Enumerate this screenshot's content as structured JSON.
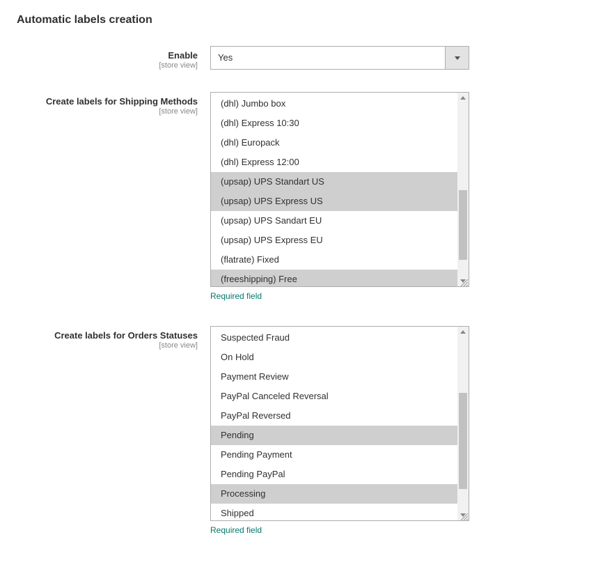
{
  "section": {
    "title": "Automatic labels creation"
  },
  "fields": {
    "enable": {
      "label": "Enable",
      "scope": "[store view]",
      "value": "Yes"
    },
    "shipping_methods": {
      "label": "Create labels for Shipping Methods",
      "scope": "[store view]",
      "note": "Required field",
      "items": [
        {
          "text": "(dhl) Jumbo box",
          "selected": false
        },
        {
          "text": "(dhl) Express 10:30",
          "selected": false
        },
        {
          "text": "(dhl) Europack",
          "selected": false
        },
        {
          "text": "(dhl) Express 12:00",
          "selected": false
        },
        {
          "text": "(upsap) UPS Standart US",
          "selected": true
        },
        {
          "text": "(upsap) UPS Express US",
          "selected": true
        },
        {
          "text": "(upsap) UPS Sandart EU",
          "selected": false
        },
        {
          "text": "(upsap) UPS Express EU",
          "selected": false
        },
        {
          "text": "(flatrate) Fixed",
          "selected": false
        },
        {
          "text": "(freeshipping) Free",
          "selected": true
        }
      ],
      "scrollbar": {
        "thumb_top_pct": 50,
        "thumb_height_pct": 40
      }
    },
    "order_statuses": {
      "label": "Create labels for Orders Statuses",
      "scope": "[store view]",
      "note": "Required field",
      "items": [
        {
          "text": "Suspected Fraud",
          "selected": false
        },
        {
          "text": "On Hold",
          "selected": false
        },
        {
          "text": "Payment Review",
          "selected": false
        },
        {
          "text": "PayPal Canceled Reversal",
          "selected": false
        },
        {
          "text": "PayPal Reversed",
          "selected": false
        },
        {
          "text": "Pending",
          "selected": true
        },
        {
          "text": "Pending Payment",
          "selected": false
        },
        {
          "text": "Pending PayPal",
          "selected": false
        },
        {
          "text": "Processing",
          "selected": true
        },
        {
          "text": "Shipped",
          "selected": false
        }
      ],
      "scrollbar": {
        "thumb_top_pct": 32,
        "thumb_height_pct": 55
      }
    }
  }
}
